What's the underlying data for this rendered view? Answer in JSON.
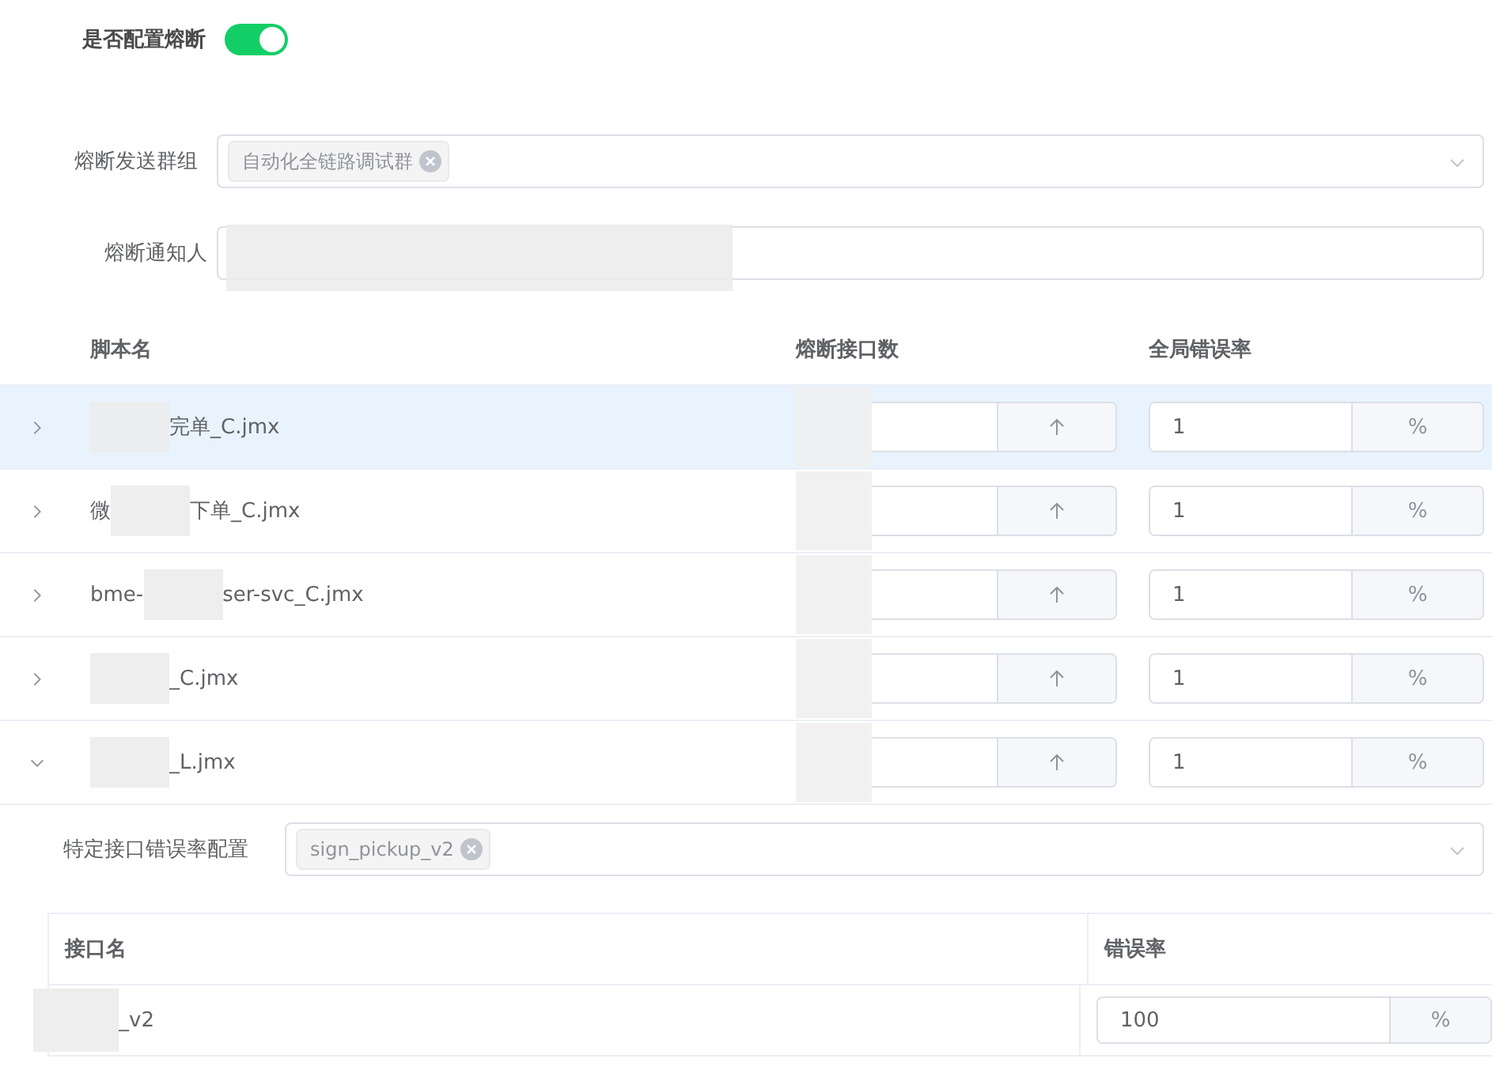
{
  "breaker_toggle": {
    "label": "是否配置熔断",
    "on": true
  },
  "send_group": {
    "label": "熔断发送群组",
    "tags": [
      "自动化全链路调试群"
    ]
  },
  "notifier": {
    "label": "熔断通知人"
  },
  "scripts_table": {
    "columns": [
      "脚本名",
      "熔断接口数",
      "全局错误率"
    ],
    "rows": [
      {
        "name_start": "",
        "name_end": "完单_C.jmx",
        "selected": true,
        "expanded": false,
        "rate": "1",
        "rate_unit": "%"
      },
      {
        "name_start": "微",
        "name_end": "下单_C.jmx",
        "selected": false,
        "expanded": false,
        "rate": "1",
        "rate_unit": "%"
      },
      {
        "name_start": "bme-",
        "name_end": "ser-svc_C.jmx",
        "selected": false,
        "expanded": false,
        "rate": "1",
        "rate_unit": "%"
      },
      {
        "name_start": "",
        "name_end": "_C.jmx",
        "selected": false,
        "expanded": false,
        "rate": "1",
        "rate_unit": "%"
      },
      {
        "name_start": "",
        "name_end": "_L.jmx",
        "selected": false,
        "expanded": true,
        "rate": "1",
        "rate_unit": "%"
      }
    ]
  },
  "specific_config": {
    "label": "特定接口错误率配置",
    "tags": [
      "sign_pickup_v2"
    ],
    "columns": [
      "接口名",
      "错误率"
    ],
    "rows": [
      {
        "name_end": "_v2",
        "rate": "100",
        "rate_unit": "%"
      }
    ]
  }
}
